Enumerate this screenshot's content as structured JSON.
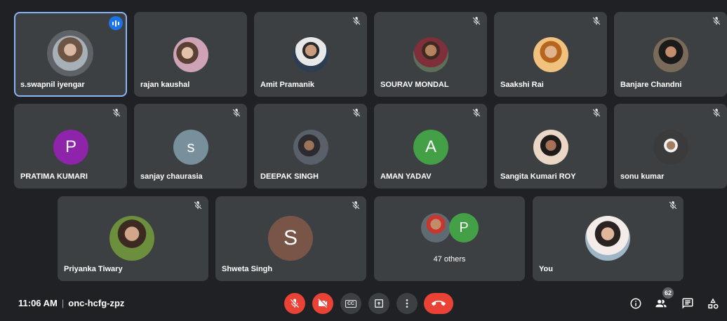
{
  "participants": [
    {
      "name": "s.swapnil iyengar",
      "kind": "photo"
    },
    {
      "name": "rajan kaushal",
      "kind": "photo"
    },
    {
      "name": "Amit Pramanik",
      "kind": "photo"
    },
    {
      "name": "SOURAV MONDAL",
      "kind": "photo"
    },
    {
      "name": "Saakshi Rai",
      "kind": "photo"
    },
    {
      "name": "Banjare Chandni",
      "kind": "photo"
    },
    {
      "name": "PRATIMA KUMARI",
      "kind": "initial",
      "initial": "P",
      "color": "#8e24aa"
    },
    {
      "name": "sanjay chaurasia",
      "kind": "initial",
      "initial": "s",
      "color": "#78909c"
    },
    {
      "name": "DEEPAK SINGH",
      "kind": "photo"
    },
    {
      "name": "AMAN YADAV",
      "kind": "initial",
      "initial": "A",
      "color": "#43a047"
    },
    {
      "name": "Sangita Kumari ROY",
      "kind": "photo"
    },
    {
      "name": "sonu kumar",
      "kind": "photo"
    },
    {
      "name": "Priyanka Tiwary",
      "kind": "photo"
    },
    {
      "name": "Shweta Singh",
      "kind": "initial",
      "initial": "S",
      "color": "#795548"
    },
    {
      "name": "You",
      "kind": "photo"
    }
  ],
  "others": {
    "label": "47 others",
    "initial": "P",
    "initial_color": "#43a047"
  },
  "meeting": {
    "time": "11:06 AM",
    "separator": "|",
    "code": "onc-hcfg-zpz"
  },
  "controls": {
    "mic": "mic-off",
    "camera": "camera-off",
    "captions": "CC",
    "present": "present-screen",
    "more": "more-options",
    "leave": "end-call"
  },
  "right_panel": {
    "people_count": "62"
  },
  "colors": {
    "background": "#202124",
    "tile": "#3c4043",
    "active_border": "#8ab4f8",
    "danger": "#ea4335",
    "speaking": "#1a73e8"
  }
}
